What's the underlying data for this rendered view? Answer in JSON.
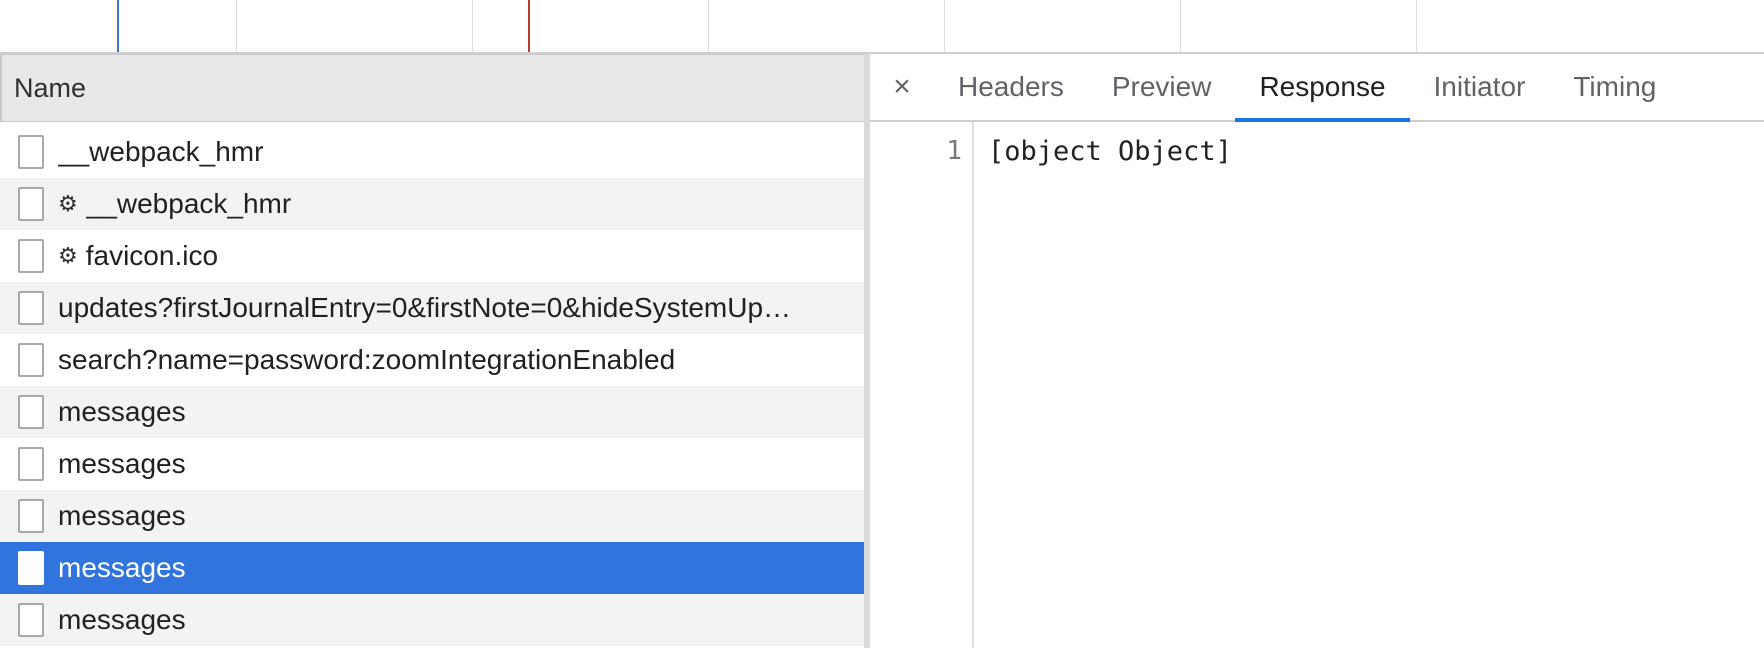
{
  "request_list": {
    "header": "Name",
    "rows": [
      {
        "label": "__webpack_hmr",
        "gear": false,
        "selected": false
      },
      {
        "label": "__webpack_hmr",
        "gear": true,
        "selected": false
      },
      {
        "label": "favicon.ico",
        "gear": true,
        "selected": false
      },
      {
        "label": "updates?firstJournalEntry=0&firstNote=0&hideSystemUp…",
        "gear": false,
        "selected": false
      },
      {
        "label": "search?name=password:zoomIntegrationEnabled",
        "gear": false,
        "selected": false
      },
      {
        "label": "messages",
        "gear": false,
        "selected": false
      },
      {
        "label": "messages",
        "gear": false,
        "selected": false
      },
      {
        "label": "messages",
        "gear": false,
        "selected": false
      },
      {
        "label": "messages",
        "gear": false,
        "selected": true
      },
      {
        "label": "messages",
        "gear": false,
        "selected": false
      }
    ]
  },
  "details": {
    "close_label": "×",
    "tabs": [
      "Headers",
      "Preview",
      "Response",
      "Initiator",
      "Timing"
    ],
    "active_tab": "Response",
    "response": {
      "line_number": "1",
      "content": "[object Object]"
    }
  },
  "icons": {
    "gear": "gear-icon",
    "close": "close-icon"
  },
  "colors": {
    "selected_row": "#3274dd",
    "active_tab_underline": "#1a73e8",
    "timeline_blue_marker": "#3b73d9",
    "timeline_red_marker": "#c0392b"
  }
}
